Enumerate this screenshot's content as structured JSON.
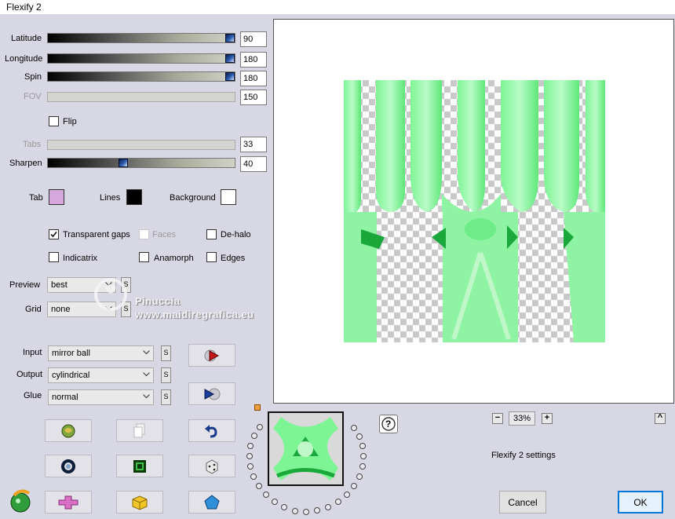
{
  "window": {
    "title": "Flexify 2"
  },
  "sliders": [
    {
      "label": "Latitude",
      "value": "90",
      "level": 1.0,
      "enabled": true
    },
    {
      "label": "Longitude",
      "value": "180",
      "level": 1.0,
      "enabled": true
    },
    {
      "label": "Spin",
      "value": "180",
      "level": 1.0,
      "enabled": true
    },
    {
      "label": "FOV",
      "value": "150",
      "level": 0,
      "enabled": false
    },
    {
      "label": "Tabs",
      "value": "33",
      "level": 0,
      "enabled": false
    },
    {
      "label": "Sharpen",
      "value": "40",
      "level": 0.4,
      "enabled": true
    }
  ],
  "flip": {
    "label": "Flip",
    "checked": false
  },
  "colors": {
    "tab_label": "Tab",
    "tab": "#d4a8dc",
    "lines_label": "Lines",
    "lines": "#000000",
    "background_label": "Background",
    "background": "#ffffff"
  },
  "options": {
    "transparent_gaps": {
      "label": "Transparent gaps",
      "checked": true
    },
    "faces": {
      "label": "Faces",
      "checked": false
    },
    "dehalo": {
      "label": "De-halo",
      "checked": false
    },
    "indicatrix": {
      "label": "Indicatrix",
      "checked": false
    },
    "anamorph": {
      "label": "Anamorph",
      "checked": false
    },
    "edges": {
      "label": "Edges",
      "checked": false
    }
  },
  "selects": {
    "preview": {
      "label": "Preview",
      "value": "best"
    },
    "grid": {
      "label": "Grid",
      "value": "none"
    },
    "input": {
      "label": "Input",
      "value": "mirror ball"
    },
    "output": {
      "label": "Output",
      "value": "cylindrical"
    },
    "glue": {
      "label": "Glue",
      "value": "normal"
    }
  },
  "s_label": "S",
  "watermark": {
    "name": "Pinuccia",
    "site": "www.maidiregrafica.eu"
  },
  "zoom": {
    "value": "33%",
    "minus": "−",
    "plus": "+"
  },
  "help": "?",
  "collapse": "^",
  "settings_label": "Flexify 2 settings",
  "buttons": {
    "cancel": "Cancel",
    "ok": "OK"
  },
  "accent": {
    "green": "#5ee87a",
    "dark_green": "#1aa83a"
  },
  "icons": [
    "randomize-icon",
    "copy-icon",
    "undo-icon",
    "ring-icon",
    "frame-icon",
    "dice-icon",
    "cross-icon",
    "cube-icon",
    "pentagon-icon",
    "play-icon",
    "fast-forward-icon",
    "app-logo-icon",
    "help-icon"
  ]
}
